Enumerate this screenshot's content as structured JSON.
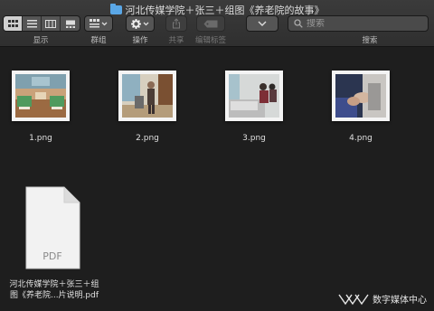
{
  "window": {
    "title": "河北传媒学院＋张三＋组图《养老院的故事》"
  },
  "toolbar": {
    "view_label": "显示",
    "group_label": "群组",
    "action_label": "操作",
    "share_label": "共享",
    "tags_label": "编辑标签",
    "search_label": "搜索",
    "search_placeholder": "搜索"
  },
  "files": [
    {
      "name": "1.png"
    },
    {
      "name": "2.png"
    },
    {
      "name": "3.png"
    },
    {
      "name": "4.png"
    }
  ],
  "pdf": {
    "badge": "PDF",
    "name_line1": "河北传媒学院＋张三＋组",
    "name_line2": "图《养老院...片说明.pdf"
  },
  "watermark": {
    "text": "数字媒体中心"
  },
  "colors": {
    "background": "#1e1e1e",
    "toolbar": "#2f2f2f",
    "folder_icon": "#5aa7e6"
  }
}
